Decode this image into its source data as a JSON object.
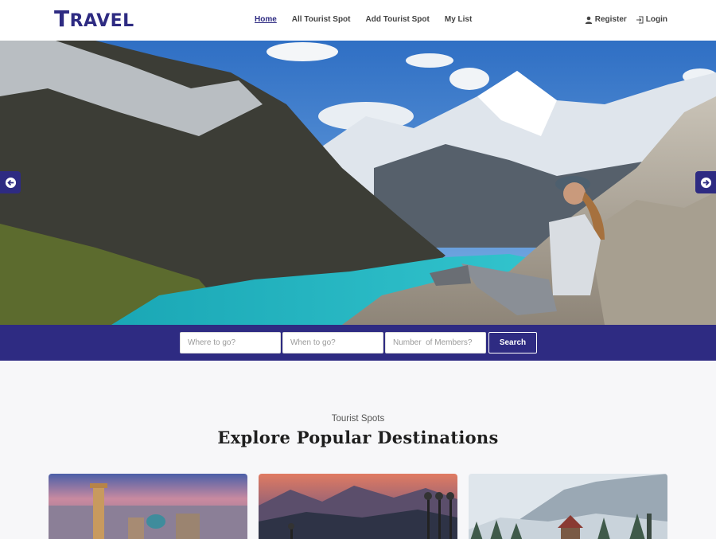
{
  "brand": {
    "logo_first": "T",
    "logo_rest": "RAVEL",
    "color": "#2e2b82"
  },
  "nav": {
    "links": [
      "Home",
      "All Tourist Spot",
      "Add Tourist Spot",
      "My List"
    ],
    "active": "Home"
  },
  "auth": {
    "register": "Register",
    "login": "Login"
  },
  "hero": {
    "prev_icon": "arrow-left-circle-icon",
    "next_icon": "arrow-right-circle-icon"
  },
  "search": {
    "where_placeholder": "Where to go?",
    "when_placeholder": "When to go?",
    "members_placeholder": "Number  of Members?",
    "button": "Search"
  },
  "section": {
    "subtitle": "Tourist Spots",
    "title": "Explore Popular Destinations"
  }
}
